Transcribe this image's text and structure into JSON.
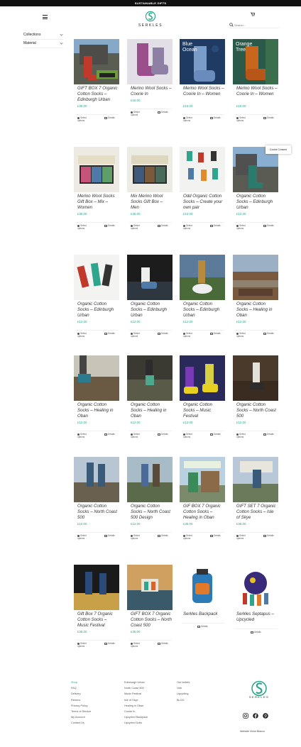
{
  "topbar": {
    "text": "SUSTAINABLE GIFTS"
  },
  "header": {
    "logo_text": "SERKLES",
    "search_placeholder": "Search..."
  },
  "filters": [
    {
      "label": "Collections"
    },
    {
      "label": "Material"
    }
  ],
  "cookie": {
    "label": "Cookie Consent"
  },
  "colors": {
    "accent": "#2ea58c"
  },
  "products": [
    {
      "title": "GIFT BOX 7 Organic Cotton Socks – Edinburgh Urban",
      "price": "£35.00",
      "primary": "Select options",
      "secondary": "Details"
    },
    {
      "title": "Merino Wool Socks – Coorie In",
      "price": "£15.00",
      "primary": "Select options",
      "secondary": "Details"
    },
    {
      "title": "Merino Wool Socks – Coorie In – Women",
      "price": "£15.00",
      "primary": "Select options",
      "secondary": "Details",
      "overlay": "Blue Ocean"
    },
    {
      "title": "Merino Wool Socks – Coorie In – Women",
      "price": "£15.00",
      "primary": "Select options",
      "secondary": "Details",
      "overlay": "Orange Tree"
    },
    {
      "title": "Merino Wool Socks Gift Box – Mix – Women",
      "price": "£35.00",
      "primary": "Select options",
      "secondary": "Details"
    },
    {
      "title": "Mix Merino Wool Socks Gift Box – Men",
      "price": "£35.00",
      "primary": "Select options",
      "secondary": "Details"
    },
    {
      "title": "Odd Organic Cotton Socks – Create your own pair",
      "price": "£10.00",
      "primary": "Select options",
      "secondary": "Details"
    },
    {
      "title": "Organic Cotton Socks – Edinburgh Urban",
      "price": "£12.00",
      "primary": "Select options",
      "secondary": "Details"
    },
    {
      "title": "Organic Cotton Socks – Edinburgh Urban",
      "price": "£12.00",
      "primary": "Select options",
      "secondary": "Details"
    },
    {
      "title": "Organic Cotton Socks – Edinburgh Urban",
      "price": "£12.00",
      "primary": "Select options",
      "secondary": "Details"
    },
    {
      "title": "Organic Cotton Socks – Edinburgh Urban",
      "price": "£12.00",
      "primary": "Select options",
      "secondary": "Details"
    },
    {
      "title": "Organic Cotton Socks – Healing in Oban",
      "price": "£12.00",
      "primary": "Select options",
      "secondary": "Details"
    },
    {
      "title": "Organic Cotton Socks – Healing in Oban",
      "price": "£12.00",
      "primary": "Select options",
      "secondary": "Details"
    },
    {
      "title": "Organic Cotton Socks – Healing in Oban",
      "price": "£12.00",
      "primary": "Select options",
      "secondary": "Details"
    },
    {
      "title": "Organic Cotton Socks – Music Festival",
      "price": "£12.00",
      "primary": "Select options",
      "secondary": "Details"
    },
    {
      "title": "Organic Cotton Socks – North Coast 500",
      "price": "£12.00",
      "primary": "Select options",
      "secondary": "Details"
    },
    {
      "title": "Organic Cotton Socks – North Coast 500",
      "price": "£10.00",
      "primary": "Select options",
      "secondary": "Details"
    },
    {
      "title": "Organic Cotton Socks – North Coast 500 Design",
      "price": "£12.00",
      "primary": "Select options",
      "secondary": "Details"
    },
    {
      "title": "GIF BOX 7 Organic Cotton Socks – Healing in Oban",
      "price": "£35.00",
      "primary": "Select options",
      "secondary": "Details"
    },
    {
      "title": "GIFT SET 7 Organic Cotton Socks – Isle of Skye",
      "price": "£35.00",
      "primary": "Select options",
      "secondary": "Details"
    },
    {
      "title": "Gift Box 7 Organic Cotton Socks – Music Festival",
      "price": "£35.00",
      "primary": "Select options",
      "secondary": "Details"
    },
    {
      "title": "GIFT BOX 7 Organic Cotton Socks – North Coast 500",
      "price": "£35.00",
      "primary": "Select options",
      "secondary": "Details"
    },
    {
      "title": "Serkles Backpack",
      "price": "",
      "primary": "",
      "secondary": "Details"
    },
    {
      "title": "Serkles Septapus – Upcycled",
      "price": "",
      "primary": "",
      "secondary": "Details"
    }
  ],
  "footer": {
    "col1": [
      "Shop",
      "FAQ",
      "Delivery",
      "Returns",
      "Privacy Policy",
      "Terms of Service",
      "My Account",
      "Contact Us"
    ],
    "col2": [
      "Edinburgh Urban",
      "North Coast 500",
      "Music Festival",
      "Isle of Skye",
      "Healing in Oban",
      "Coorie In",
      "Upcycled Backpack",
      "Upcycled Dolls"
    ],
    "col3": [
      "Our beliefs",
      "Vole",
      "Upcycling",
      "BLOG"
    ],
    "logo_text": "SERKLES",
    "social": [
      "instagram-icon",
      "facebook-icon",
      "pinterest-icon"
    ],
    "credit": "Website Victor Blanco"
  }
}
